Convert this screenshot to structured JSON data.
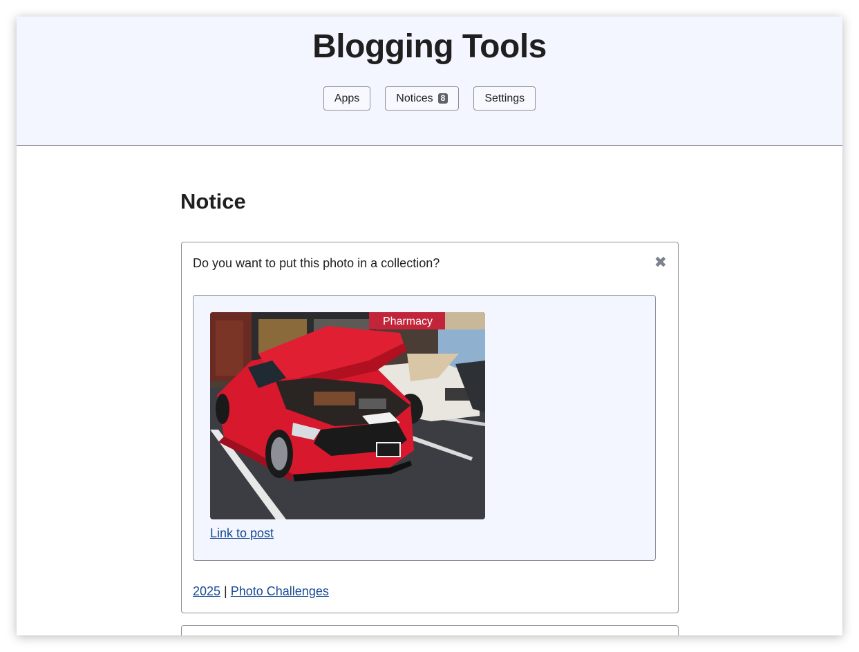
{
  "site": {
    "title": "Blogging Tools"
  },
  "nav": {
    "apps_label": "Apps",
    "notices_label": "Notices",
    "notices_count": "8",
    "settings_label": "Settings"
  },
  "page": {
    "heading": "Notice"
  },
  "notice": {
    "question": "Do you want to put this photo in a collection?",
    "close_glyph": "✖",
    "photo_alt": "Red Mustang with open hood parked beside a white classic Mustang outside a pharmacy",
    "link_label": "Link to post",
    "tags": [
      {
        "label": "2025"
      },
      {
        "label": "Photo Challenges"
      }
    ],
    "tag_separator": " | "
  },
  "colors": {
    "header_bg": "#f3f6fe",
    "link": "#174a94",
    "border": "#8a8f99",
    "badge_bg": "#5f6268"
  }
}
